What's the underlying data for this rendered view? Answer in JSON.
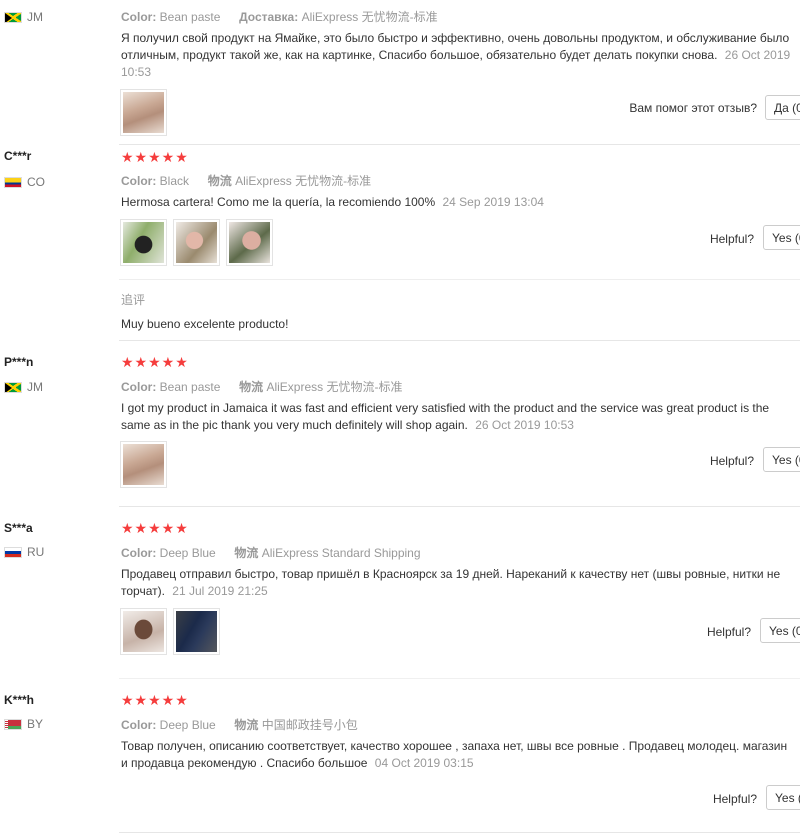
{
  "reviews": [
    {
      "user": "",
      "country": "JM",
      "flag": "jm",
      "rating": "★★★★★",
      "color_label": "Color:",
      "color_value": "Bean paste",
      "shipping_label": "Доставка:",
      "shipping_value": "AliExpress 无忧物流-标准",
      "text": "Я получил свой продукт на Ямайке, это было быстро и эффективно, очень довольны продуктом, и обслуживание было отличным, продукт такой же, как на картинке, Спасибо большое, обязательно будет делать покупки снова.",
      "date": "26 Oct 2019 10:53",
      "helpful_label": "Вам помог этот отзыв?",
      "vote_label": "Да (0)"
    },
    {
      "user": "C***r",
      "country": "CO",
      "flag": "co",
      "rating": "★★★★★",
      "color_label": "Color:",
      "color_value": "Black",
      "shipping_label": "物流",
      "shipping_value": "AliExpress 无忧物流-标准",
      "text": "Hermosa cartera! Como me la quería, la recomiendo 100%",
      "date": "24 Sep 2019 13:04",
      "helpful_label": "Helpful?",
      "vote_label": "Yes (0)",
      "followup_label": "追评",
      "followup_text": "Muy bueno excelente producto!"
    },
    {
      "user": "P***n",
      "country": "JM",
      "flag": "jm",
      "rating": "★★★★★",
      "color_label": "Color:",
      "color_value": "Bean paste",
      "shipping_label": "物流",
      "shipping_value": "AliExpress 无忧物流-标准",
      "text": "I got my product in Jamaica it was fast and efficient very satisfied with the product and the service was great product is the same as in the pic thank you very much definitely will shop again.",
      "date": "26 Oct 2019 10:53",
      "helpful_label": "Helpful?",
      "vote_label": "Yes (0)"
    },
    {
      "user": "S***a",
      "country": "RU",
      "flag": "ru",
      "rating": "★★★★★",
      "color_label": "Color:",
      "color_value": "Deep Blue",
      "shipping_label": "物流",
      "shipping_value": "AliExpress Standard Shipping",
      "text": "Продавец отправил быстро, товар пришёл в Красноярск за 19 дней. Нареканий к качеству нет (швы ровные, нитки не торчат).",
      "date": "21 Jul 2019 21:25",
      "helpful_label": "Helpful?",
      "vote_label": "Yes (0)"
    },
    {
      "user": "K***h",
      "country": "BY",
      "flag": "by",
      "rating": "★★★★★",
      "color_label": "Color:",
      "color_value": "Deep Blue",
      "shipping_label": "物流",
      "shipping_value": "中国邮政挂号小包",
      "text": "Товар получен, описанию соответствует, качество хорошее , запаха нет, швы все ровные . Продавец молодец. магазин и продавца рекомендую . Спасибо большое",
      "date": "04 Oct 2019 03:15",
      "helpful_label": "Helpful?",
      "vote_label": "Yes (0)"
    }
  ]
}
